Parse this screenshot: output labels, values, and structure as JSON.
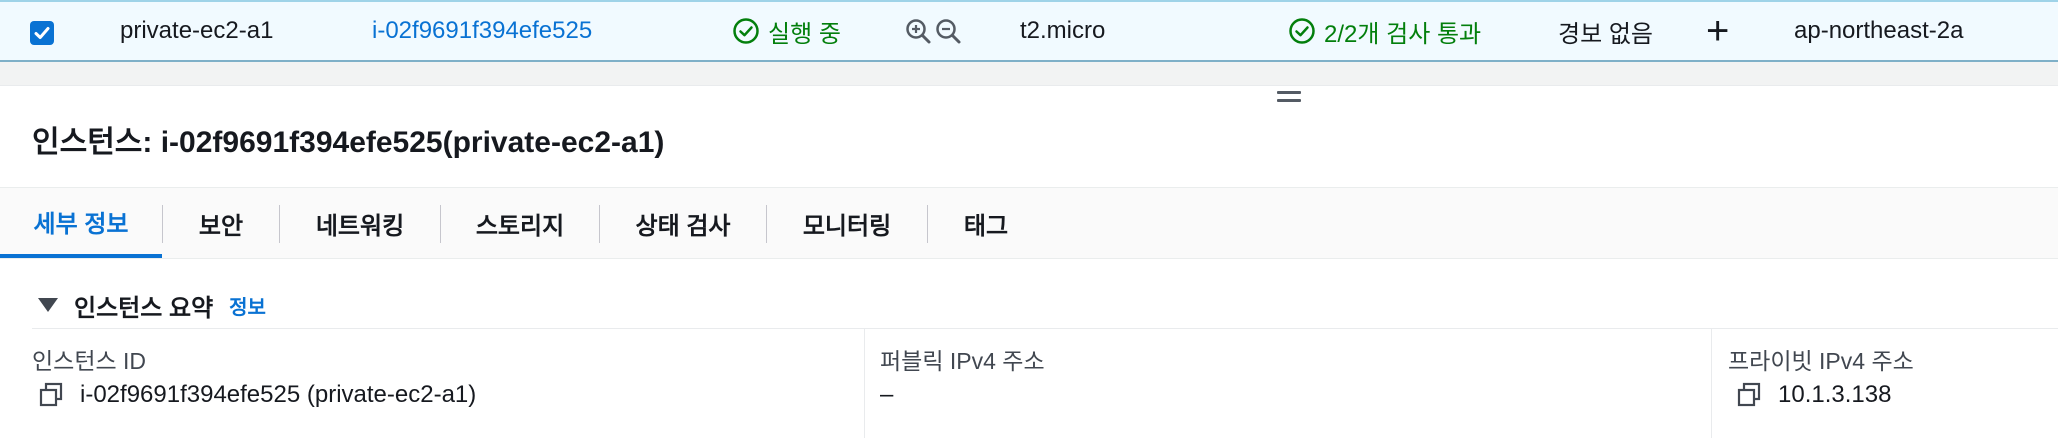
{
  "instance_row": {
    "selected": true,
    "name": "private-ec2-a1",
    "instance_id": "i-02f9691f394efe525",
    "state": "실행 중",
    "instance_type": "t2.micro",
    "status_check": "2/2개 검사 통과",
    "alarm_status": "경보 없음",
    "add_alarm": "+",
    "availability_zone": "ap-northeast-2a"
  },
  "details": {
    "title": "인스턴스: i-02f9691f394efe525(private-ec2-a1)",
    "tabs": [
      {
        "label": "세부 정보",
        "active": true
      },
      {
        "label": "보안"
      },
      {
        "label": "네트워킹"
      },
      {
        "label": "스토리지"
      },
      {
        "label": "상태 검사"
      },
      {
        "label": "모니터링"
      },
      {
        "label": "태그"
      }
    ],
    "summary": {
      "heading": "인스턴스 요약",
      "info_link": "정보",
      "fields": [
        {
          "label": "인스턴스 ID",
          "value": "i-02f9691f394efe525 (private-ec2-a1)",
          "copyable": true
        },
        {
          "label": "퍼블릭 IPv4 주소",
          "value": "–",
          "copyable": false
        },
        {
          "label": "프라이빗 IPv4 주소",
          "value": "10.1.3.138",
          "copyable": true
        }
      ]
    }
  },
  "colors": {
    "link": "#0972d3",
    "success": "#037f0c",
    "row_selected_bg": "#f1faff"
  },
  "icons": [
    "checkbox-checked-icon",
    "success-check-icon",
    "zoom-in-icon",
    "zoom-out-icon",
    "drag-handle-icon",
    "caret-down-icon",
    "copy-icon"
  ]
}
